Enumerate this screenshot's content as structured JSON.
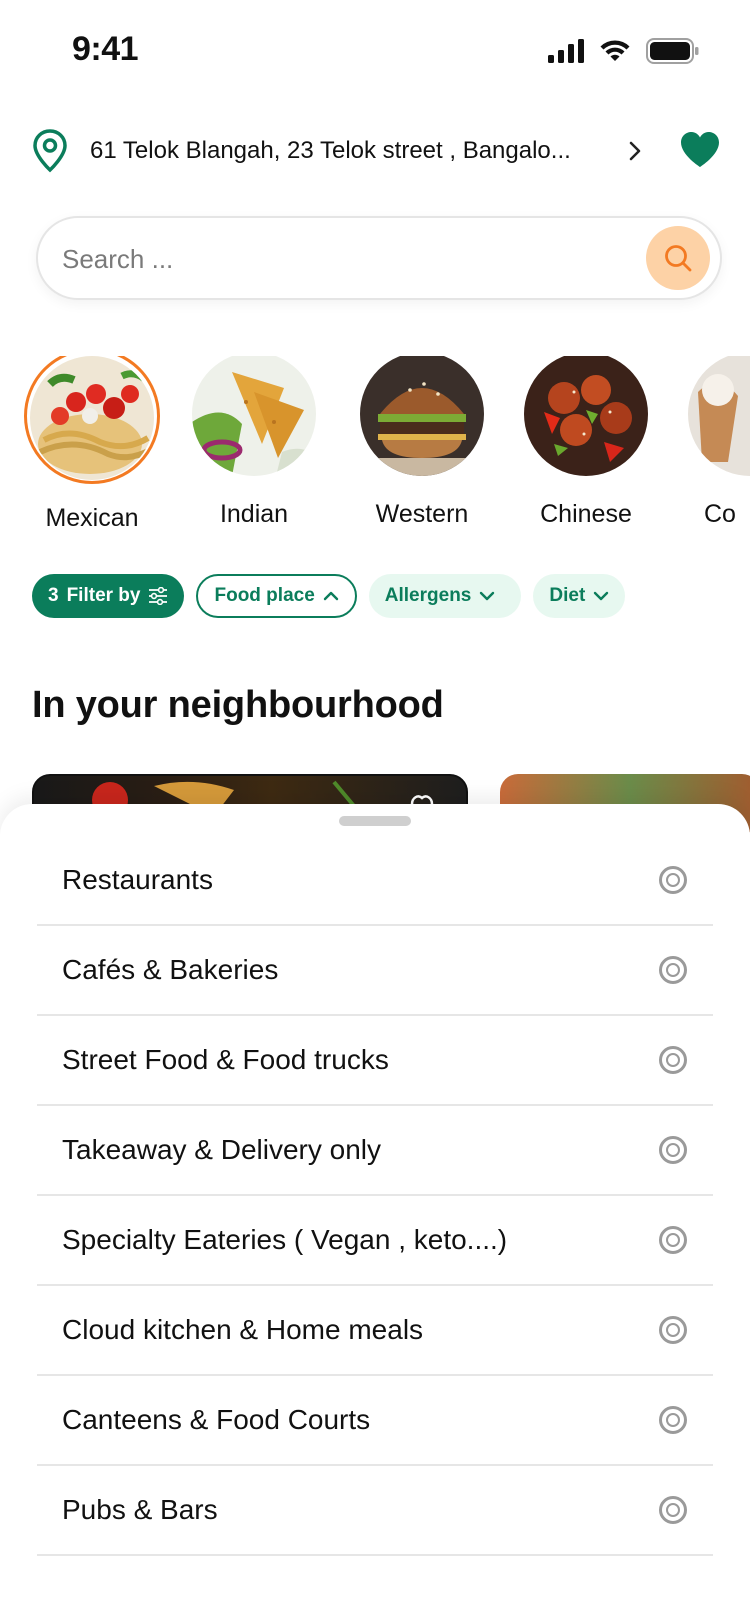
{
  "status_bar": {
    "time": "9:41"
  },
  "location": {
    "address": "61 Telok Blangah, 23 Telok street , Bangalo..."
  },
  "search": {
    "placeholder": "Search ..."
  },
  "cuisines": [
    {
      "label": "Mexican",
      "active": true
    },
    {
      "label": "Indian",
      "active": false
    },
    {
      "label": "Western",
      "active": false
    },
    {
      "label": "Chinese",
      "active": false
    },
    {
      "label": "Co",
      "active": false
    }
  ],
  "filters": {
    "filter_count": "3",
    "filter_label": "Filter by",
    "food_place": "Food place",
    "allergens": "Allergens",
    "diet": "Diet"
  },
  "section": {
    "title": "In your neighbourhood"
  },
  "food_place_options": [
    "Restaurants",
    "Cafés & Bakeries",
    "Street Food & Food trucks",
    "Takeaway & Delivery only",
    "Specialty Eateries ( Vegan , keto....)",
    "Cloud kitchen & Home meals",
    "Canteens & Food Courts",
    "Pubs & Bars"
  ],
  "colors": {
    "brand_green": "#0b7d5b",
    "accent_orange": "#f37a22",
    "search_button": "#fdd2a6"
  }
}
